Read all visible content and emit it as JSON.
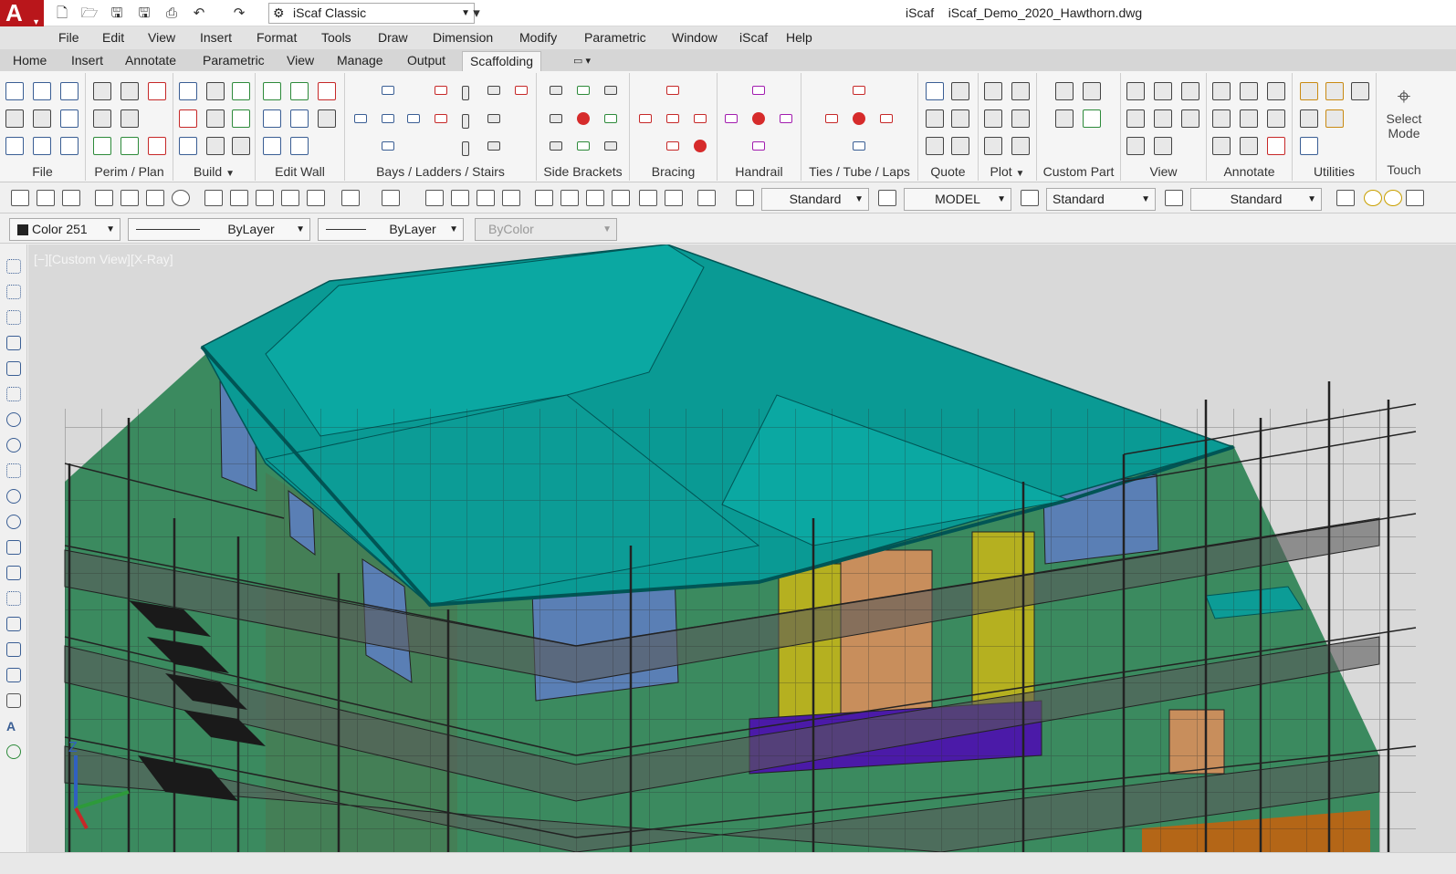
{
  "title_bar": {
    "app_name": "iScaf",
    "document": "iScaf_Demo_2020_Hawthorn.dwg",
    "workspace": "iScaf Classic",
    "logo_letter": "A"
  },
  "menu": [
    "File",
    "Edit",
    "View",
    "Insert",
    "Format",
    "Tools",
    "Draw",
    "Dimension",
    "Modify",
    "Parametric",
    "Window",
    "iScaf",
    "Help"
  ],
  "ribbon_tabs": [
    "Home",
    "Insert",
    "Annotate",
    "Parametric",
    "View",
    "Manage",
    "Output",
    "Scaffolding"
  ],
  "ribbon_active_tab": "Scaffolding",
  "panels": [
    "File",
    "Perim / Plan",
    "Build",
    "Edit Wall",
    "Bays /  Ladders / Stairs",
    "Side Brackets",
    "Bracing",
    "Handrail",
    "Ties / Tube / Laps",
    "Quote",
    "Plot",
    "Custom Part",
    "View",
    "Annotate",
    "Utilities"
  ],
  "touch": {
    "line1": "Select",
    "line2": "Mode",
    "label": "Touch"
  },
  "toolbar1": {
    "text_style": "Standard",
    "layout": "MODEL",
    "dim_style": "Standard",
    "table_style": "Standard"
  },
  "toolbar2": {
    "color": "Color 251",
    "linetype": "ByLayer",
    "lineweight": "ByLayer",
    "plotstyle": "ByColor"
  },
  "viewport": {
    "label": "[−][Custom View][X-Ray]",
    "ucs_z": "Z"
  },
  "colors": {
    "roof": "#0a9a94",
    "wall": "#3b8a5f",
    "window": "#5a7fb5",
    "accent": "#b9161b",
    "scaffold": "#2a2a2a",
    "deck": "#5a5a5a"
  }
}
